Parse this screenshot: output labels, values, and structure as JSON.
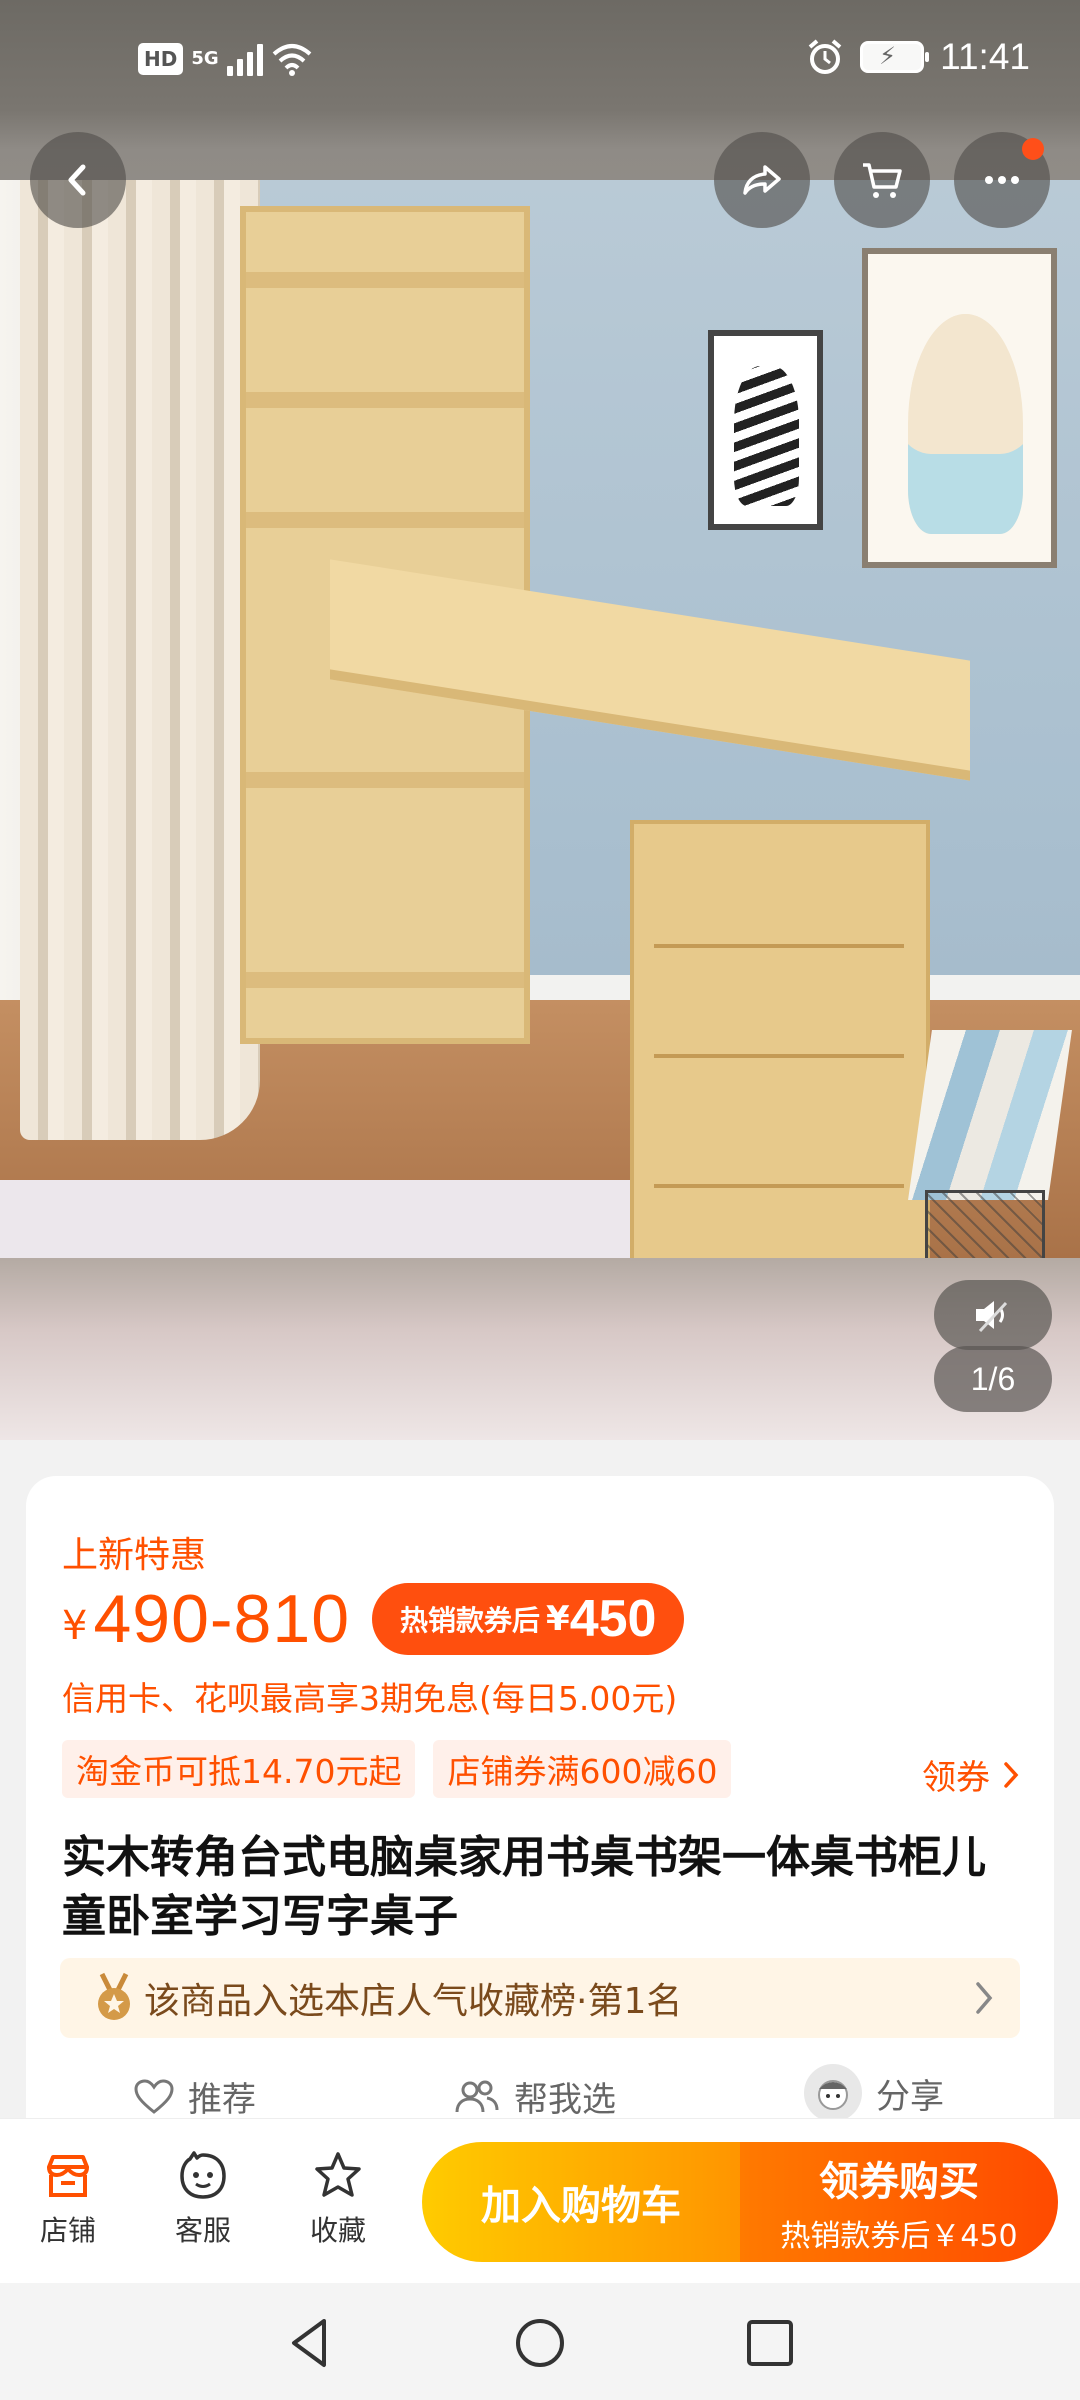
{
  "status_bar": {
    "hd": "HD",
    "network": "5G",
    "time": "11:41"
  },
  "gallery": {
    "counter": "1/6"
  },
  "price_card": {
    "promo_title": "上新特惠",
    "currency": "¥",
    "price_range": "490-810",
    "hot_label": "热销款券后",
    "hot_currency": "¥",
    "hot_price": "450",
    "installment": "信用卡、花呗最高享3期免息(每日5.00元)",
    "chips": [
      "淘金币可抵14.70元起",
      "店铺券满600减60"
    ],
    "coupon_link": "领券"
  },
  "product": {
    "title": "实木转角台式电脑桌家用书桌书架一体桌书柜儿童卧室学习写字桌子",
    "rank_text": "该商品入选本店人气收藏榜·第1名"
  },
  "actions": {
    "recommend": "推荐",
    "help_choose": "帮我选",
    "share": "分享"
  },
  "bottom_bar": {
    "store": "店铺",
    "service": "客服",
    "favorite": "收藏",
    "add_cart": "加入购物车",
    "buy_title": "领券购买",
    "buy_sub": "热销款券后￥450"
  },
  "colors": {
    "accent": "#ff5000",
    "cart_gradient": [
      "#ffcb00",
      "#ff9500"
    ],
    "buy_gradient": [
      "#ff7a00",
      "#ff4a00"
    ]
  },
  "icons": [
    "back-icon",
    "share-icon",
    "cart-icon",
    "more-icon",
    "mute-icon",
    "heart-icon",
    "people-icon",
    "store-icon",
    "service-icon",
    "star-icon",
    "medal-icon",
    "chevron-right-icon"
  ]
}
